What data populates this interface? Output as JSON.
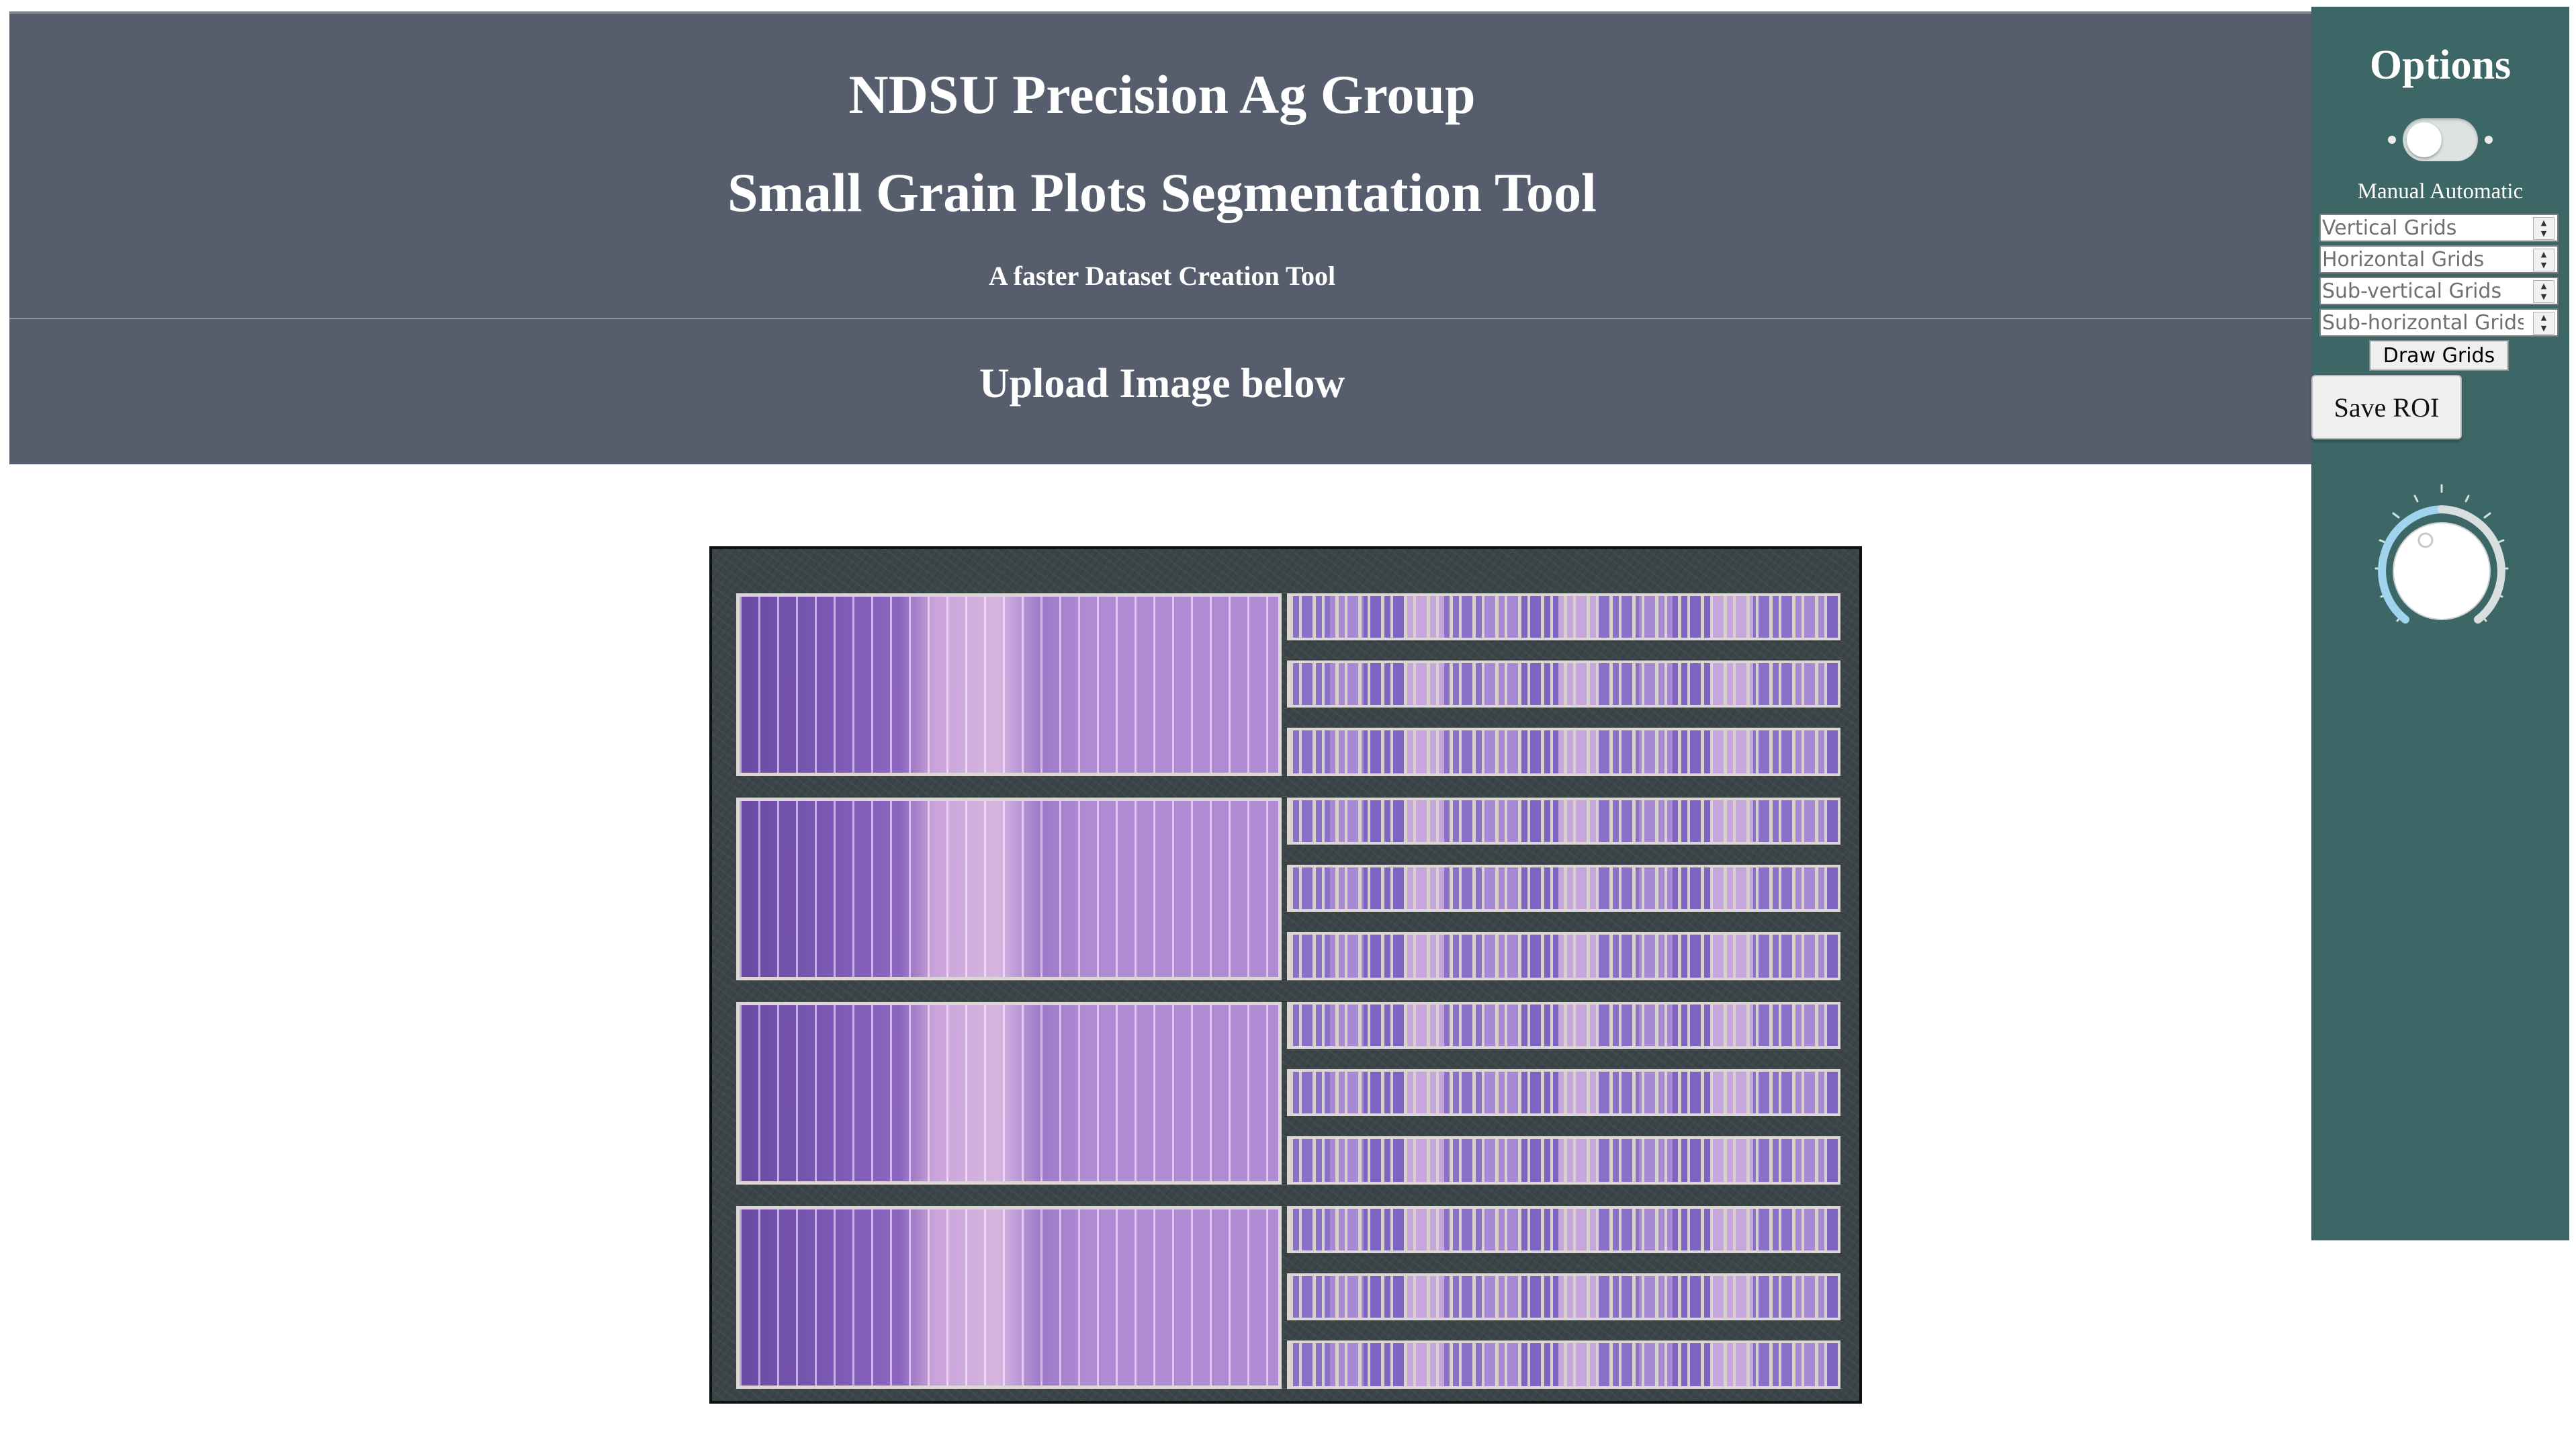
{
  "header": {
    "title": "NDSU Precision Ag Group",
    "subtitle": "Small Grain Plots Segmentation Tool",
    "tagline": "A faster Dataset Creation Tool",
    "upload_label": "Upload Image below"
  },
  "options": {
    "title": "Options",
    "mode_toggle": {
      "labels": "Manual Automatic",
      "state": "Manual"
    },
    "inputs": [
      {
        "placeholder": "Vertical Grids",
        "value": ""
      },
      {
        "placeholder": "Horizontal Grids",
        "value": ""
      },
      {
        "placeholder": "Sub-vertical Grids",
        "value": ""
      },
      {
        "placeholder": "Sub-horizontal Grids",
        "value": ""
      }
    ],
    "draw_grids_label": "Draw Grids",
    "save_roi_label": "Save ROI",
    "rotation_knob": {
      "icon": "rotation-dial-icon",
      "accent_color": "#9fd3ee"
    }
  },
  "colors": {
    "header_bg": "#565e6e",
    "sidebar_bg": "#3d6767",
    "header_text": "#ffffff"
  },
  "field_image": {
    "alt": "uploaded field image of small grain plots"
  }
}
